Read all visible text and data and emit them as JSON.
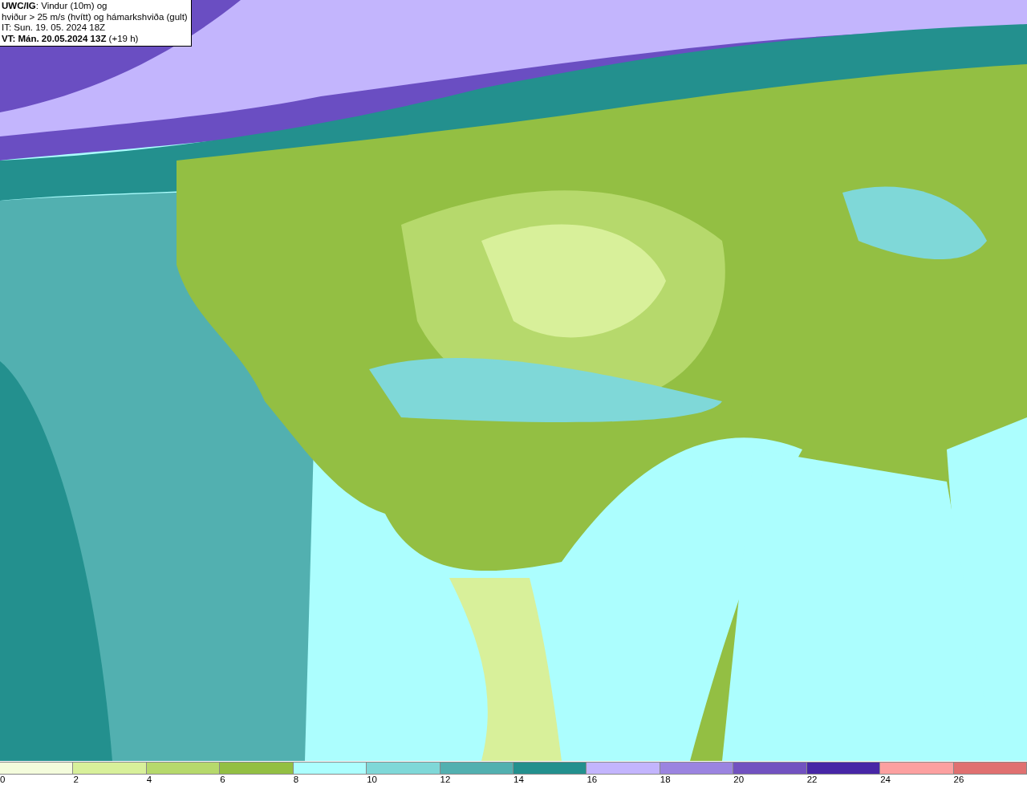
{
  "info_box": {
    "lines": [
      {
        "text": "**UWC/IG**: Vindur (10m) og"
      },
      {
        "text": "hviður > 25 m/s (hvítt) og hámarkshviða (gult)"
      },
      {
        "text": "IT: Sun. 19. 05. 2024 18Z"
      },
      {
        "text": "**VT: Mán. 20.05.2024 13Z** (+19 h)"
      }
    ]
  },
  "legend": [
    {
      "label": "0",
      "color": "#f4fcdc"
    },
    {
      "label": "2",
      "color": "#d8f09a"
    },
    {
      "label": "4",
      "color": "#b6d96c"
    },
    {
      "label": "6",
      "color": "#93bf43"
    },
    {
      "label": "8",
      "color": "#acfefe"
    },
    {
      "label": "10",
      "color": "#7fd8d8"
    },
    {
      "label": "12",
      "color": "#52b0b0"
    },
    {
      "label": "14",
      "color": "#23908e"
    },
    {
      "label": "16",
      "color": "#c3b5fd"
    },
    {
      "label": "18",
      "color": "#9b84e0"
    },
    {
      "label": "20",
      "color": "#7252c0"
    },
    {
      "label": "22",
      "color": "#4726a6"
    },
    {
      "label": "24",
      "color": "#fca0a0"
    },
    {
      "label": "26",
      "color": "#e07070"
    }
  ]
}
